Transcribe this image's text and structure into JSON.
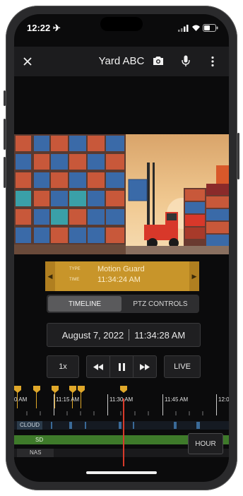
{
  "status": {
    "time": "12:22 ✈"
  },
  "header": {
    "title": "Yard ABC"
  },
  "event": {
    "type_label": "TYPE",
    "type_value": "Motion Guard",
    "time_label": "TIME",
    "time_value": "11:34:24 AM"
  },
  "tabs": [
    {
      "label": "TIMELINE",
      "active": true
    },
    {
      "label": "PTZ CONTROLS",
      "active": false
    }
  ],
  "playback": {
    "date": "August 7, 2022",
    "time": "11:34:28 AM",
    "speed": "1x",
    "live": "LIVE"
  },
  "timeline": {
    "ticks": [
      "0 AM",
      "11:15 AM",
      "11:30 AM",
      "11:45 AM",
      "12:0"
    ],
    "tracks": [
      "CLOUD",
      "SD",
      "NAS"
    ],
    "zoom": "HOUR"
  },
  "colors": {
    "accent": "#c8952a",
    "sd_track": "#3e7a2a",
    "cursor": "#d83a2a"
  }
}
